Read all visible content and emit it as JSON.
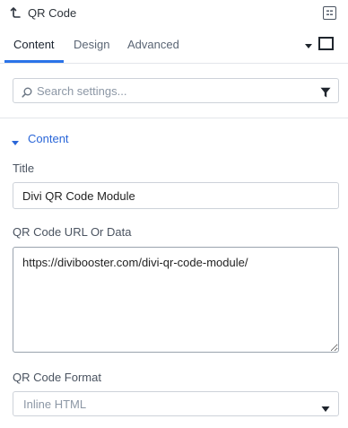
{
  "header": {
    "title": "QR Code",
    "back_icon": "back-arrow-icon",
    "module_icon": "module-settings-icon"
  },
  "tabs": [
    {
      "label": "Content",
      "active": true
    },
    {
      "label": "Design",
      "active": false
    },
    {
      "label": "Advanced",
      "active": false
    }
  ],
  "search": {
    "placeholder": "Search settings...",
    "icon": "search-icon",
    "filter_icon": "filter-icon"
  },
  "section": {
    "label": "Content",
    "expanded": true
  },
  "fields": {
    "title": {
      "label": "Title",
      "value": "Divi QR Code Module"
    },
    "url": {
      "label": "QR Code URL Or Data",
      "value": "https://divibooster.com/divi-qr-code-module/"
    },
    "format": {
      "label": "QR Code Format",
      "selected": "Inline HTML"
    }
  },
  "colors": {
    "accent": "#2a73e8",
    "section_label": "#2a66d8"
  }
}
